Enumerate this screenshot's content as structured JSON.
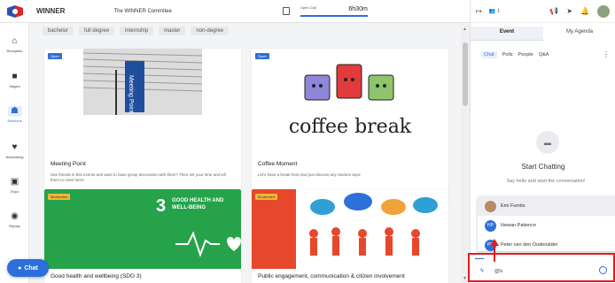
{
  "header": {
    "app_title": "WINNER",
    "committee": "The WINNER Commitee",
    "timer_label": "Open Call",
    "timer_value": "6h30m"
  },
  "nav": [
    {
      "label": "Reception",
      "icon": "home-icon"
    },
    {
      "label": "Stages",
      "icon": "video-icon"
    },
    {
      "label": "Sessions",
      "icon": "people-group-icon"
    },
    {
      "label": "Networking",
      "icon": "handshake-icon"
    },
    {
      "label": "Expo",
      "icon": "building-icon"
    },
    {
      "label": "Replay",
      "icon": "play-circle-icon"
    }
  ],
  "chat_button": "Chat",
  "tags": [
    "bachelor",
    "full degree",
    "internship",
    "master",
    "non-degree"
  ],
  "cards": [
    {
      "badge": "Open",
      "title": "Meeting Point",
      "desc": "See friends in this events and want to have group discussion with them? Then set your time and tell them to meet here!",
      "views": "0",
      "sign": "Meeting Point"
    },
    {
      "badge": "Open",
      "title": "Coffee Moment",
      "desc": "Let's have a break here and just discuss any random topic",
      "views": "0",
      "sign": "coffee break"
    },
    {
      "badge": "Moderated",
      "title": "Good health and wellbeing (SDG 3)",
      "sdg_num": "3",
      "sdg_text": "GOOD HEALTH AND WELL-BEING"
    },
    {
      "badge": "Moderated",
      "title": "Public engagement, communication & citizen involvement"
    }
  ],
  "right": {
    "count": "1",
    "tabs": [
      "Event",
      "My Agenda"
    ],
    "subtabs": [
      "Chat",
      "Polls",
      "People",
      "Q&A"
    ],
    "empty_title": "Start Chatting",
    "empty_hint": "Say hello and start the conversation!",
    "mentions": [
      {
        "initials": "",
        "name": "Emi Fumits",
        "color": "#b98a64"
      },
      {
        "initials": "HP",
        "name": "Hewan Patience",
        "color": "#2f6fd8"
      },
      {
        "initials": "PO",
        "name": "Peter van den Oudenalder",
        "color": "#2f6fd8"
      }
    ],
    "input_value": "@s"
  }
}
